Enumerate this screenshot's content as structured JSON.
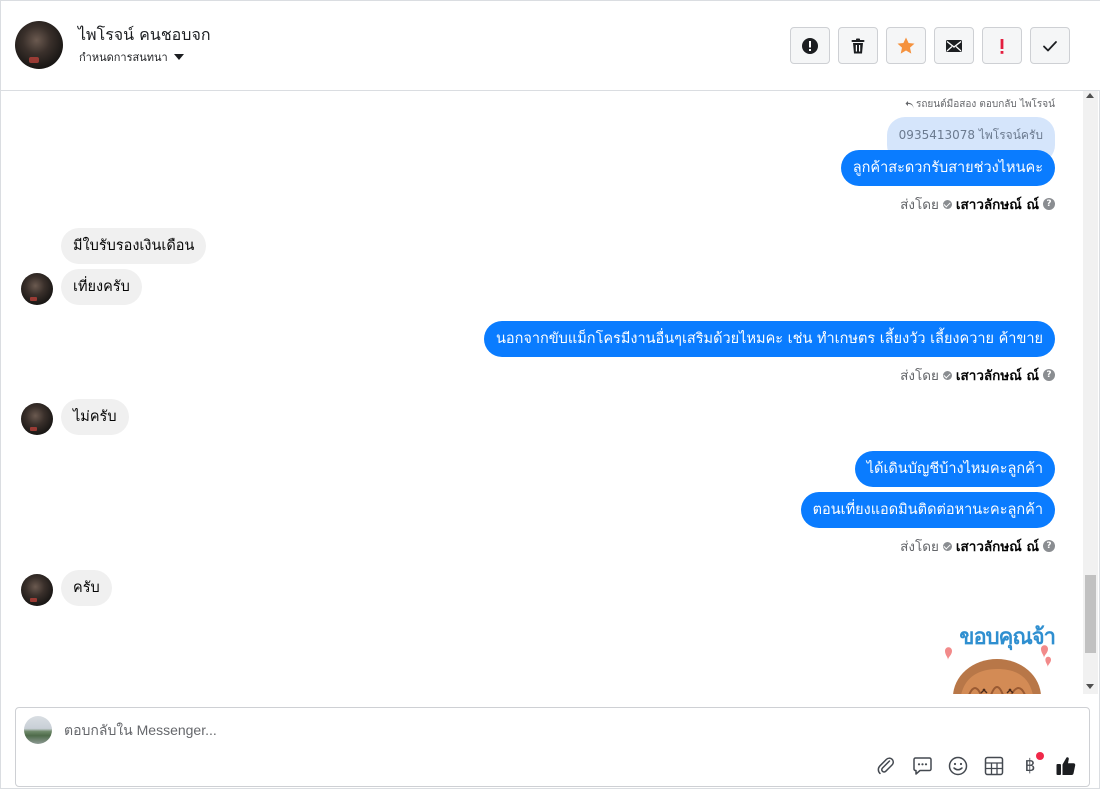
{
  "header": {
    "contact_name": "ไพโรจน์ คนชอบจก",
    "assign_label": "กำหนดการสนทนา",
    "actions": [
      {
        "name": "spam-icon",
        "label": "!"
      },
      {
        "name": "trash-icon",
        "label": ""
      },
      {
        "name": "star-icon",
        "label": ""
      },
      {
        "name": "envelope-icon",
        "label": ""
      },
      {
        "name": "exclamation-icon",
        "label": "!"
      },
      {
        "name": "check-icon",
        "label": ""
      }
    ]
  },
  "conversation": {
    "reply_note": "รถยนต์มือสอง ตอบกลับ ไพโรจน์",
    "quoted_message": "0935413078 ไพโรจน์ครับ",
    "messages": [
      {
        "direction": "out",
        "text": "ลูกค้าสะดวกรับสายช่วงไหนคะ"
      },
      {
        "direction": "in",
        "text": "มีใบรับรองเงินเดือน"
      },
      {
        "direction": "in",
        "text": "เที่ยงครับ"
      },
      {
        "direction": "out",
        "text": "นอกจากขับแม็กโครมีงานอื่นๆเสริมด้วยไหมคะ เช่น ทำเกษตร เลี้ยงวัว เลี้ยงควาย ค้าขาย"
      },
      {
        "direction": "in",
        "text": "ไม่ครับ"
      },
      {
        "direction": "out",
        "text": "ได้เดินบัญชีบ้างไหมคะลูกค้า"
      },
      {
        "direction": "out",
        "text": "ตอนเที่ยงแอดมินติดต่อหานะคะลูกค้า"
      },
      {
        "direction": "in",
        "text": "ครับ"
      }
    ],
    "sent_by_label": "ส่งโดย",
    "agent_name": "เสาวลักษณ์ ณ์",
    "sticker_text": "ขอบคุณจ้า"
  },
  "composer": {
    "placeholder": "ตอบกลับใน Messenger...",
    "tools": [
      "paperclip-icon",
      "quick-reply-icon",
      "emoji-icon",
      "template-icon",
      "baht-icon",
      "thumbs-up-icon"
    ],
    "baht_symbol": "฿"
  },
  "colors": {
    "outgoing_bubble": "#0a7cff",
    "incoming_bubble": "#f0f0f0",
    "quoted_bubble": "#d5e5fb",
    "star": "#f5923e",
    "alert_red": "#e41e3f"
  }
}
